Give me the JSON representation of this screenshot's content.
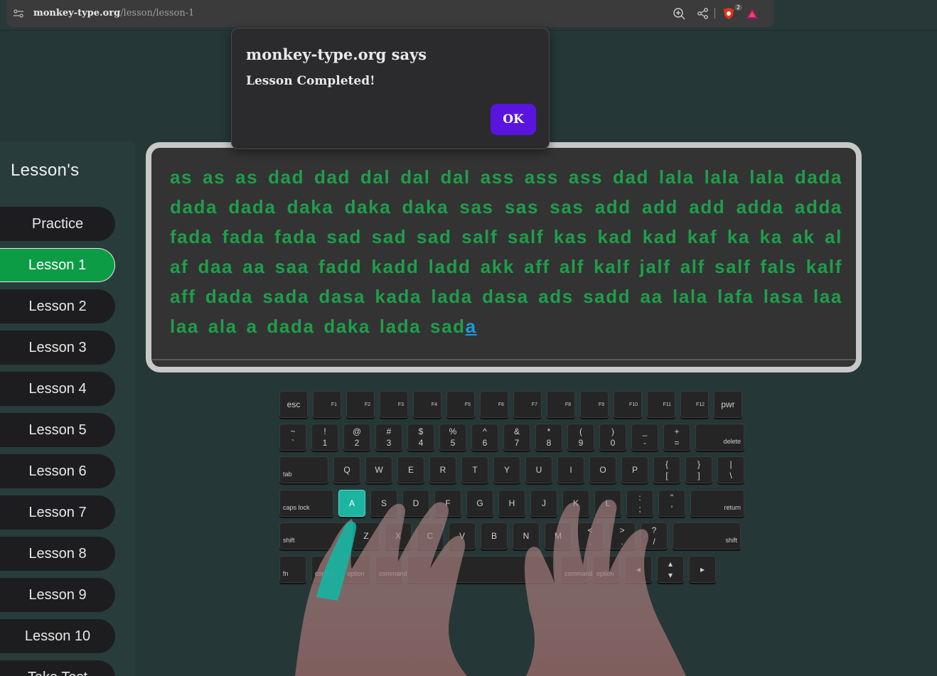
{
  "browser": {
    "url_domain": "monkey-type.org",
    "url_path": "/lesson/lesson-1",
    "shields_count": "2"
  },
  "dialog": {
    "title": "monkey-type.org says",
    "message": "Lesson Completed!",
    "ok_label": "OK"
  },
  "sidebar": {
    "title": "Lesson's",
    "items": [
      {
        "label": "Practice"
      },
      {
        "label": "Lesson 1",
        "active": true
      },
      {
        "label": "Lesson 2"
      },
      {
        "label": "Lesson 3"
      },
      {
        "label": "Lesson 4"
      },
      {
        "label": "Lesson 5"
      },
      {
        "label": "Lesson 6"
      },
      {
        "label": "Lesson 7"
      },
      {
        "label": "Lesson 8"
      },
      {
        "label": "Lesson 9"
      },
      {
        "label": "Lesson 10"
      },
      {
        "label": "Take Test"
      }
    ]
  },
  "typing": {
    "typed_text": "as as as dad dad dal dal dal ass ass ass dad lala lala lala dada dada dada daka daka daka sas sas sas add add add adda adda fada fada fada sad sad sad salf salf kas kad kad kaf ka ka ak al af daa aa saa fadd kadd ladd akk aff alf kalf jalf alf salf fals kalf aff dada sada dasa kada lada dasa ads sadd aa lala lafa lasa laa laa ala a dada daka lada sad",
    "current_char": "a"
  },
  "keyboard": {
    "highlighted_key": "A",
    "rows": [
      [
        {
          "l": "esc",
          "t": "c",
          "w": 40
        },
        {
          "l": "F1",
          "t": "fn",
          "w": 40
        },
        {
          "l": "F2",
          "t": "fn",
          "w": 40
        },
        {
          "l": "F3",
          "t": "fn",
          "w": 40
        },
        {
          "l": "F4",
          "t": "fn",
          "w": 40
        },
        {
          "l": "F5",
          "t": "fn",
          "w": 40
        },
        {
          "l": "F6",
          "t": "fn",
          "w": 40
        },
        {
          "l": "F7",
          "t": "fn",
          "w": 40
        },
        {
          "l": "F8",
          "t": "fn",
          "w": 40
        },
        {
          "l": "F9",
          "t": "fn",
          "w": 40
        },
        {
          "l": "F10",
          "t": "fn",
          "w": 40
        },
        {
          "l": "F11",
          "t": "fn",
          "w": 40
        },
        {
          "l": "F12",
          "t": "fn",
          "w": 40
        },
        {
          "l": "pwr",
          "t": "c",
          "w": 40
        }
      ],
      [
        {
          "u": "~",
          "d": "`",
          "t": "d",
          "w": 38
        },
        {
          "u": "!",
          "d": "1",
          "t": "d",
          "w": 38
        },
        {
          "u": "@",
          "d": "2",
          "t": "d",
          "w": 38
        },
        {
          "u": "#",
          "d": "3",
          "t": "d",
          "w": 38
        },
        {
          "u": "$",
          "d": "4",
          "t": "d",
          "w": 38
        },
        {
          "u": "%",
          "d": "5",
          "t": "d",
          "w": 38
        },
        {
          "u": "^",
          "d": "6",
          "t": "d",
          "w": 38
        },
        {
          "u": "&",
          "d": "7",
          "t": "d",
          "w": 38
        },
        {
          "u": "*",
          "d": "8",
          "t": "d",
          "w": 38
        },
        {
          "u": "(",
          "d": "9",
          "t": "d",
          "w": 38
        },
        {
          "u": ")",
          "d": "0",
          "t": "d",
          "w": 38
        },
        {
          "u": "_",
          "d": "-",
          "t": "d",
          "w": 38
        },
        {
          "u": "+",
          "d": "=",
          "t": "d",
          "w": 38
        },
        {
          "l": "delete",
          "t": "br",
          "w": 69
        }
      ],
      [
        {
          "l": "tab",
          "t": "bl",
          "w": 69
        },
        {
          "l": "Q",
          "t": "c",
          "w": 38
        },
        {
          "l": "W",
          "t": "c",
          "w": 38
        },
        {
          "l": "E",
          "t": "c",
          "w": 38
        },
        {
          "l": "R",
          "t": "c",
          "w": 38
        },
        {
          "l": "T",
          "t": "c",
          "w": 38
        },
        {
          "l": "Y",
          "t": "c",
          "w": 38
        },
        {
          "l": "U",
          "t": "c",
          "w": 38
        },
        {
          "l": "I",
          "t": "c",
          "w": 38
        },
        {
          "l": "O",
          "t": "c",
          "w": 38
        },
        {
          "l": "P",
          "t": "c",
          "w": 38
        },
        {
          "u": "{",
          "d": "[",
          "t": "d",
          "w": 38
        },
        {
          "u": "}",
          "d": "]",
          "t": "d",
          "w": 38
        },
        {
          "u": "|",
          "d": "\\",
          "t": "d",
          "w": 38
        }
      ],
      [
        {
          "l": "caps lock",
          "t": "bl",
          "w": 76
        },
        {
          "l": "A",
          "t": "c",
          "w": 38
        },
        {
          "l": "S",
          "t": "c",
          "w": 38
        },
        {
          "l": "D",
          "t": "c",
          "w": 38
        },
        {
          "l": "F",
          "t": "c",
          "w": 38
        },
        {
          "l": "G",
          "t": "c",
          "w": 38
        },
        {
          "l": "H",
          "t": "c",
          "w": 38
        },
        {
          "l": "J",
          "t": "c",
          "w": 38
        },
        {
          "l": "K",
          "t": "c",
          "w": 38
        },
        {
          "l": "L",
          "t": "c",
          "w": 38
        },
        {
          "u": ":",
          "d": ";",
          "t": "d",
          "w": 38
        },
        {
          "u": "\"",
          "d": "'",
          "t": "d",
          "w": 38
        },
        {
          "l": "return",
          "t": "br",
          "w": 76
        }
      ],
      [
        {
          "l": "shift",
          "t": "bl",
          "w": 96
        },
        {
          "l": "Z",
          "t": "c",
          "w": 38
        },
        {
          "l": "X",
          "t": "c",
          "w": 38
        },
        {
          "l": "C",
          "t": "c",
          "w": 38
        },
        {
          "l": "V",
          "t": "c",
          "w": 38
        },
        {
          "l": "B",
          "t": "c",
          "w": 38
        },
        {
          "l": "N",
          "t": "c",
          "w": 38
        },
        {
          "l": "M",
          "t": "c",
          "w": 38
        },
        {
          "u": "<",
          "d": ",",
          "t": "d",
          "w": 38
        },
        {
          "u": ">",
          "d": ".",
          "t": "d",
          "w": 38
        },
        {
          "u": "?",
          "d": "/",
          "t": "d",
          "w": 38
        },
        {
          "l": "shift",
          "t": "br",
          "w": 96
        }
      ],
      [
        {
          "l": "fn",
          "t": "bl",
          "w": 38
        },
        {
          "l": "control",
          "t": "bl",
          "w": 38
        },
        {
          "l": "option",
          "t": "bl",
          "w": 38
        },
        {
          "l": "command",
          "t": "bl",
          "w": 38
        },
        {
          "l": "",
          "t": "c",
          "w": 209
        },
        {
          "l": "command",
          "t": "bl",
          "w": 38
        },
        {
          "l": "option",
          "t": "bl",
          "w": 38
        },
        {
          "l": "◂",
          "t": "c",
          "w": 38
        },
        {
          "u": "▴",
          "d": "▾",
          "t": "d",
          "w": 38
        },
        {
          "l": "▸",
          "t": "c",
          "w": 38
        }
      ]
    ]
  },
  "colors": {
    "background": "#253737",
    "typed_text": "#1f9e4a",
    "active_lesson": "#0c9c46",
    "dialog_ok": "#5a14e0",
    "key_highlight": "#1cb5a1",
    "cursor": "#1d9ad6"
  },
  "icons": [
    "tune-icon",
    "zoom-icon",
    "share-icon",
    "brave-shields-icon",
    "brave-rewards-icon"
  ]
}
